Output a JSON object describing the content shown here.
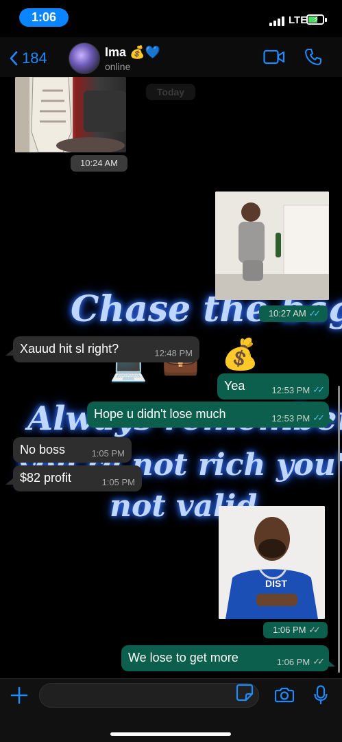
{
  "status_bar": {
    "time": "1:06",
    "network": "LTE"
  },
  "header": {
    "back_count": "184",
    "contact_name": "Ima",
    "contact_emojis": "💰💙",
    "presence": "online"
  },
  "wallpaper": {
    "line1": "Chase the bag",
    "line2": "Always remember if",
    "line3": "you're not rich you're",
    "line4": "not valid",
    "emoji_moneybag": "💰",
    "emoji_laptop": "💻",
    "emoji_briefcase": "💼"
  },
  "date_chip": "Today",
  "messages": [
    {
      "id": "m1",
      "type": "image",
      "direction": "in",
      "time": "10:24 AM"
    },
    {
      "id": "m2",
      "type": "image",
      "direction": "out",
      "time": "10:27 AM",
      "status": "read"
    },
    {
      "id": "m3",
      "type": "text",
      "direction": "in",
      "text": "Xauud hit sl right?",
      "time": "12:48 PM"
    },
    {
      "id": "m4",
      "type": "text",
      "direction": "out",
      "text": "Yea",
      "time": "12:53 PM",
      "status": "read"
    },
    {
      "id": "m5",
      "type": "text",
      "direction": "out",
      "text": "Hope u didn't lose much",
      "time": "12:53 PM",
      "status": "read"
    },
    {
      "id": "m6",
      "type": "text",
      "direction": "in",
      "text": "No boss",
      "time": "1:05 PM"
    },
    {
      "id": "m7",
      "type": "text",
      "direction": "in",
      "text": "$82 profit",
      "time": "1:05 PM"
    },
    {
      "id": "m8",
      "type": "image",
      "direction": "out",
      "time": "1:06 PM",
      "status": "delivered",
      "image_text": "DIST"
    },
    {
      "id": "m9",
      "type": "text",
      "direction": "out",
      "text": "We lose to get more",
      "time": "1:06 PM",
      "status": "delivered"
    }
  ],
  "input": {
    "value": "",
    "placeholder": ""
  },
  "colors": {
    "accent": "#1e8bff",
    "bubble_out": "#0b5f4c",
    "bubble_in": "#2e2e2e",
    "read_tick": "#53bdeb",
    "battery_charging": "#4cd964"
  },
  "icons": [
    "back-chevron-icon",
    "video-call-icon",
    "phone-call-icon",
    "plus-icon",
    "sticker-icon",
    "camera-icon",
    "microphone-icon"
  ]
}
